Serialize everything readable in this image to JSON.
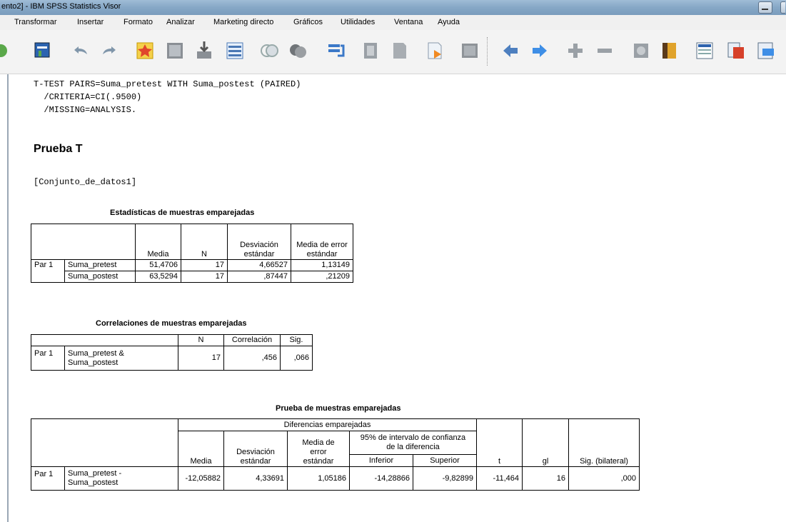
{
  "window": {
    "title": "ento2] - IBM SPSS Statistics Visor"
  },
  "menu": [
    "Transformar",
    "Insertar",
    "Formato",
    "Analizar",
    "Marketing directo",
    "Gráficos",
    "Utilidades",
    "Ventana",
    "Ayuda"
  ],
  "syntax": {
    "line1": "T-TEST PAIRS=Suma_pretest WITH Suma_postest (PAIRED)",
    "line2": "  /CRITERIA=CI(.9500)",
    "line3": "  /MISSING=ANALYSIS."
  },
  "heading": "Prueba T",
  "dataset": "[Conjunto_de_datos1]",
  "stats_table": {
    "title": "Estadísticas de muestras emparejadas",
    "headers": [
      "Media",
      "N",
      "Desviación estándar",
      "Media de error estándar"
    ],
    "pair_label": "Par 1",
    "rows": [
      {
        "var": "Suma_pretest",
        "media": "51,4706",
        "n": "17",
        "desv": "4,66527",
        "err": "1,13149"
      },
      {
        "var": "Suma_postest",
        "media": "63,5294",
        "n": "17",
        "desv": ",87447",
        "err": ",21209"
      }
    ]
  },
  "corr_table": {
    "title": "Correlaciones de muestras emparejadas",
    "headers": [
      "N",
      "Correlación",
      "Sig."
    ],
    "pair_label": "Par 1",
    "var_line1": "Suma_pretest &",
    "var_line2": "Suma_postest",
    "n": "17",
    "corr": ",456",
    "sig": ",066"
  },
  "test_table": {
    "title": "Prueba de muestras emparejadas",
    "group_header": "Diferencias emparejadas",
    "ci_header_line1": "95% de intervalo de confianza",
    "ci_header_line2": "de la diferencia",
    "headers": {
      "media": "Media",
      "desv_line1": "Desviación",
      "desv_line2": "estándar",
      "err_line1": "Media de",
      "err_line2": "error",
      "err_line3": "estándar",
      "inferior": "Inferior",
      "superior": "Superior",
      "t": "t",
      "gl": "gl",
      "sig": "Sig. (bilateral)"
    },
    "pair_label": "Par 1",
    "var_line1": "Suma_pretest -",
    "var_line2": "Suma_postest",
    "values": {
      "media": "-12,05882",
      "desv": "4,33691",
      "err": "1,05186",
      "inferior": "-14,28866",
      "superior": "-9,82899",
      "t": "-11,464",
      "gl": "16",
      "sig": ",000"
    }
  },
  "colors": {
    "titlebar": "#86a7c6",
    "gutter": "#9aa7b5"
  }
}
